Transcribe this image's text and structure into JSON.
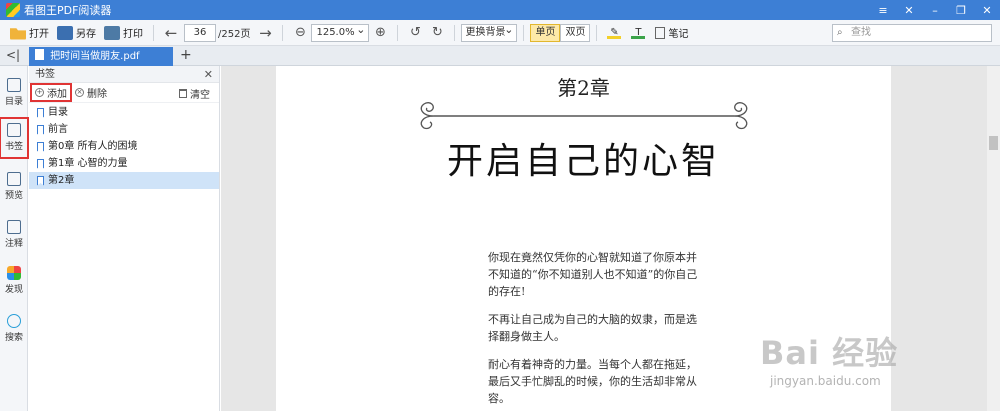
{
  "app": {
    "title": "看图王PDF阅读器"
  },
  "window_controls": [
    "≡",
    "✕",
    "–",
    "❐",
    "✕"
  ],
  "toolbar": {
    "open_label": "打开",
    "saveas_label": "另存",
    "print_label": "打印",
    "current_page": "36",
    "total_pages": "/252页",
    "zoom": "125.0%",
    "background_label": "更换背景",
    "single_page_label": "单页",
    "double_page_label": "双页",
    "notes_label": "笔记",
    "search_placeholder": "查找"
  },
  "tabs": {
    "collapse": "<|",
    "document": "把时间当做朋友.pdf",
    "add": "+"
  },
  "rail": {
    "items": [
      {
        "label": "目录",
        "icon": "toc-icon"
      },
      {
        "label": "书签",
        "icon": "bookmark-icon"
      },
      {
        "label": "预览",
        "icon": "preview-icon"
      },
      {
        "label": "注释",
        "icon": "annotation-icon"
      },
      {
        "label": "发现",
        "icon": "discover-icon"
      },
      {
        "label": "搜索",
        "icon": "search-icon"
      }
    ]
  },
  "panel": {
    "title": "书签",
    "add_label": "添加",
    "delete_label": "删除",
    "clear_label": "清空",
    "bookmarks": [
      "目录",
      "前言",
      "第0章 所有人的困境",
      "第1章 心智的力量",
      "第2章"
    ]
  },
  "document": {
    "chapter": "第2章",
    "title": "开启自己的心智",
    "paragraphs": [
      "你现在竟然仅凭你的心智就知道了你原本并不知道的“你不知道别人也不知道”的你自己的存在!",
      "不再让自己成为自己的大脑的奴隶，而是选择翻身做主人。",
      "耐心有着神奇的力量。当每个人都在拖延，最后又手忙脚乱的时候，你的生活却非常从容。"
    ]
  },
  "watermark": {
    "main": "Bai 经验",
    "sub": "jingyan.baidu.com"
  }
}
